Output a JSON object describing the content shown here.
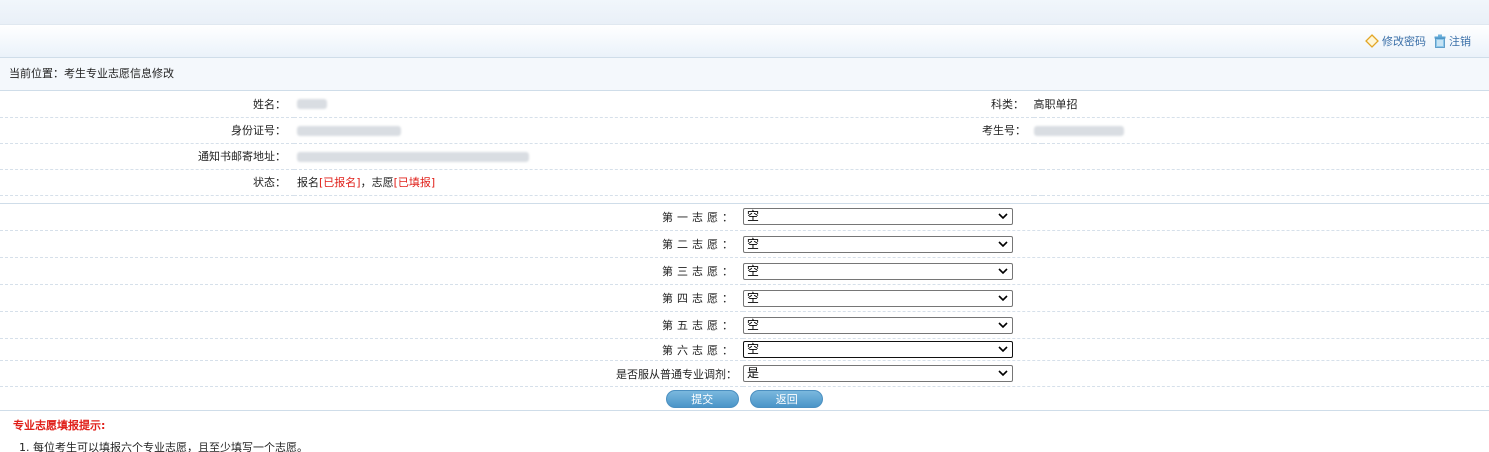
{
  "header": {
    "change_password": "修改密码",
    "logout": "注销"
  },
  "breadcrumb": {
    "text": "当前位置：考生专业志愿信息修改"
  },
  "info": {
    "name_label": "姓名：",
    "category_label": "科类：",
    "category_value": "高职单招",
    "id_label": "身份证号：",
    "exam_no_label": "考生号：",
    "address_label": "通知书邮寄地址：",
    "status_label": "状态：",
    "status_reg_prefix": "报名",
    "status_reg_value": "[已报名]",
    "status_sep": "，志愿",
    "status_wish_value": "[已填报]"
  },
  "wishes": [
    {
      "label": "第一志愿：",
      "value": "空"
    },
    {
      "label": "第二志愿：",
      "value": "空"
    },
    {
      "label": "第三志愿：",
      "value": "空"
    },
    {
      "label": "第四志愿：",
      "value": "空"
    },
    {
      "label": "第五志愿：",
      "value": "空"
    },
    {
      "label": "第六志愿：",
      "value": "空"
    }
  ],
  "adjust": {
    "label": "是否服从普通专业调剂：",
    "value": "是"
  },
  "buttons": {
    "submit": "提交",
    "back": "返回"
  },
  "tips": {
    "title": "专业志愿填报提示:",
    "item1": "1. 每位考生可以填报六个专业志愿，且至少填写一个志愿。"
  },
  "icons": {
    "edit": "diamond-edit-icon",
    "trash": "trash-icon",
    "dropdown": "chevron-down-icon"
  },
  "colors": {
    "accent": "#3a6fa8",
    "alert": "#e0201a",
    "button": "#5aa3d3"
  }
}
